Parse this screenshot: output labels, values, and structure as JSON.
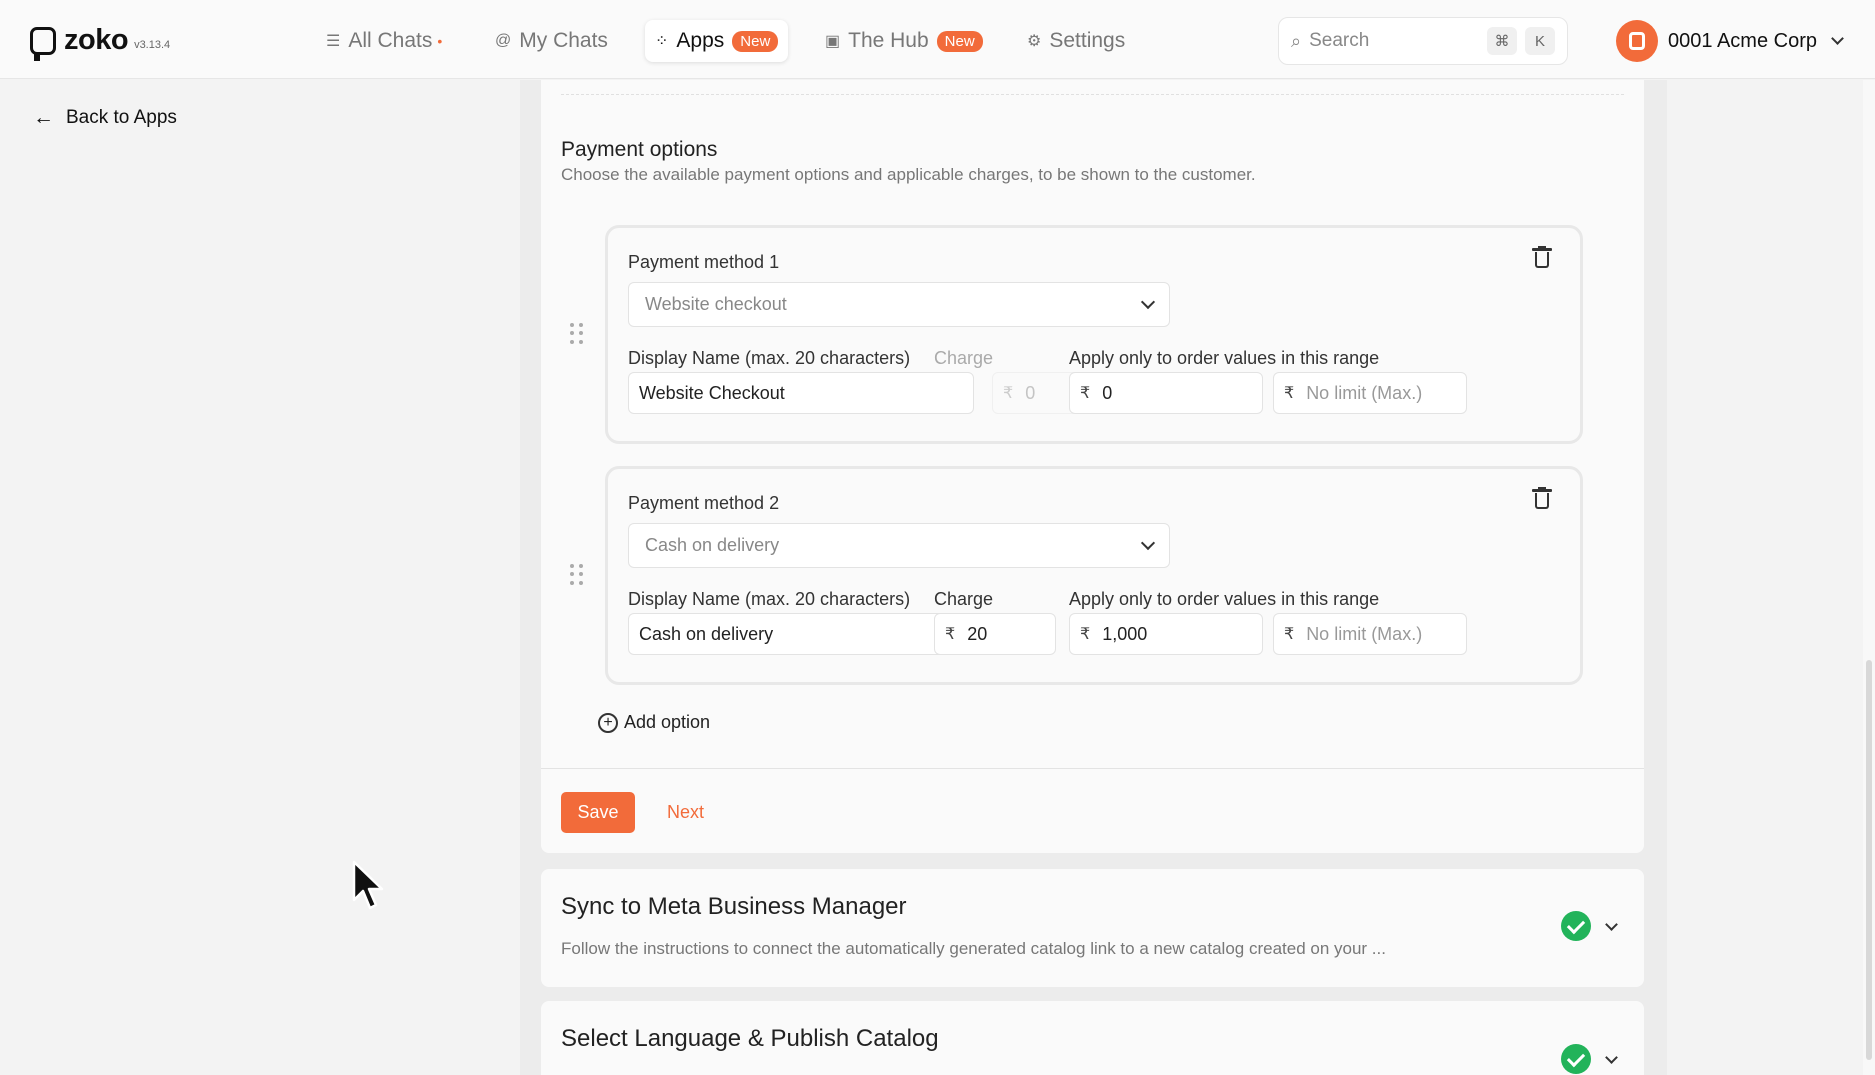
{
  "header": {
    "brand": "zoko",
    "version": "v3.13.4",
    "nav": [
      {
        "label": "All Chats",
        "icon": "list-icon"
      },
      {
        "label": "My Chats",
        "icon": "at-icon"
      },
      {
        "label": "Apps",
        "icon": "grid-icon",
        "badge": "New"
      },
      {
        "label": "The Hub",
        "icon": "chart-icon",
        "badge": "New"
      },
      {
        "label": "Settings",
        "icon": "gear-icon"
      }
    ],
    "search_placeholder": "Search",
    "shortcut_mod": "⌘",
    "shortcut_key": "K",
    "account_name": "0001 Acme Corp"
  },
  "sidebar": {
    "back_label": "Back to Apps"
  },
  "payment": {
    "title": "Payment options",
    "description": "Choose the available payment options and applicable charges, to be shown to the customer.",
    "labels": {
      "display_name": "Display Name (max. 20 characters)",
      "charge": "Charge",
      "range": "Apply only to order values in this range",
      "currency": "₹",
      "max_placeholder": "No limit (Max.)"
    },
    "methods": [
      {
        "title": "Payment method 1",
        "type": "Website checkout",
        "display_name": "Website Checkout",
        "charge": "0",
        "min": "0"
      },
      {
        "title": "Payment method 2",
        "type": "Cash on delivery",
        "display_name": "Cash on delivery",
        "charge": "20",
        "min": "1,000"
      }
    ],
    "add_option": "Add option",
    "save": "Save",
    "next": "Next"
  },
  "steps": [
    {
      "title": "Sync to Meta Business Manager",
      "description": "Follow the instructions to connect the automatically generated catalog link to a new catalog created on your ..."
    },
    {
      "title": "Select Language & Publish Catalog"
    }
  ],
  "colors": {
    "accent": "#f26b3a",
    "success": "#22b35a"
  }
}
